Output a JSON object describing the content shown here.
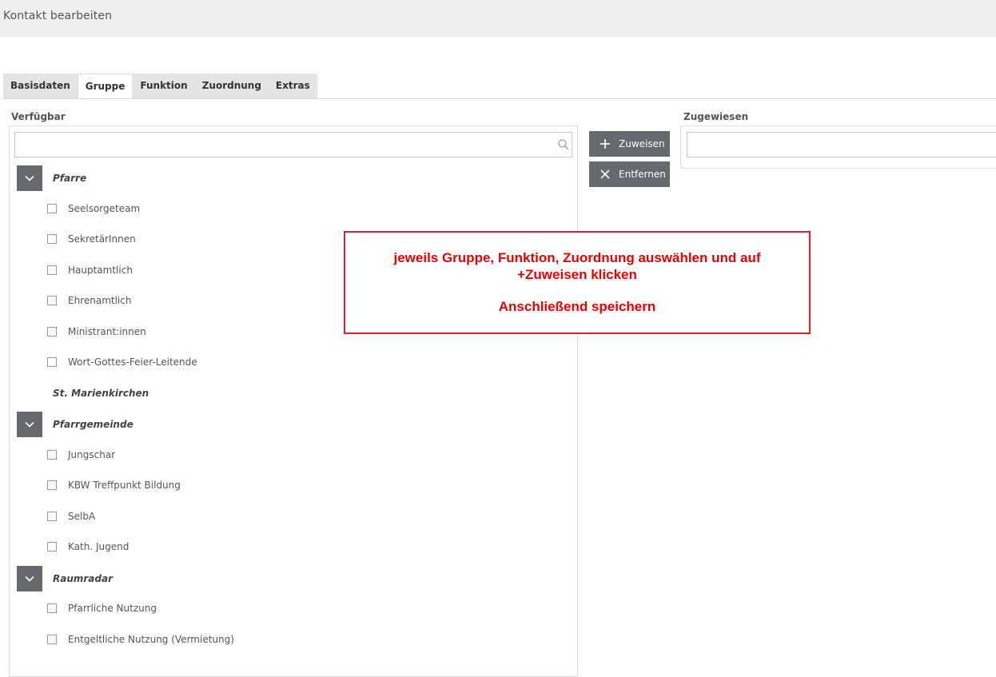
{
  "header": {
    "title": "Kontakt bearbeiten"
  },
  "tabs": [
    {
      "label": "Basisdaten",
      "active": false
    },
    {
      "label": "Gruppe",
      "active": true
    },
    {
      "label": "Funktion",
      "active": false
    },
    {
      "label": "Zuordnung",
      "active": false
    },
    {
      "label": "Extras",
      "active": false
    }
  ],
  "available": {
    "label": "Verfügbar",
    "search_placeholder": "",
    "groups": [
      {
        "name": "Pfarre",
        "expanded": true,
        "items": [
          "Seelsorgeteam",
          "SekretärInnen",
          "Hauptamtlich",
          "Ehrenamtlich",
          "Ministrant:innen",
          "Wort-Gottes-Feier-Leitende"
        ]
      },
      {
        "name": "St. Marienkirchen",
        "expanded": false,
        "items": []
      },
      {
        "name": "Pfarrgemeinde",
        "expanded": true,
        "items": [
          "Jungschar",
          "KBW Treffpunkt Bildung",
          "SelbA",
          "Kath. Jugend"
        ]
      },
      {
        "name": "Raumradar",
        "expanded": true,
        "items": [
          "Pfarrliche Nutzung",
          "Entgeltliche Nutzung (Vermietung)"
        ]
      }
    ]
  },
  "actions": {
    "assign_label": "Zuweisen",
    "remove_label": "Entfernen"
  },
  "assigned": {
    "label": "Zugewiesen",
    "placeholder": ""
  },
  "annotation": {
    "line1": "jeweils Gruppe, Funktion, Zuordnung auswählen und auf",
    "line2": "+Zuweisen  klicken",
    "line3": "Anschließend speichern",
    "color": "#e60000"
  },
  "colors": {
    "header_bg": "#efefef",
    "button_bg": "#666a6e",
    "tab_bg": "#e4e4e4"
  }
}
